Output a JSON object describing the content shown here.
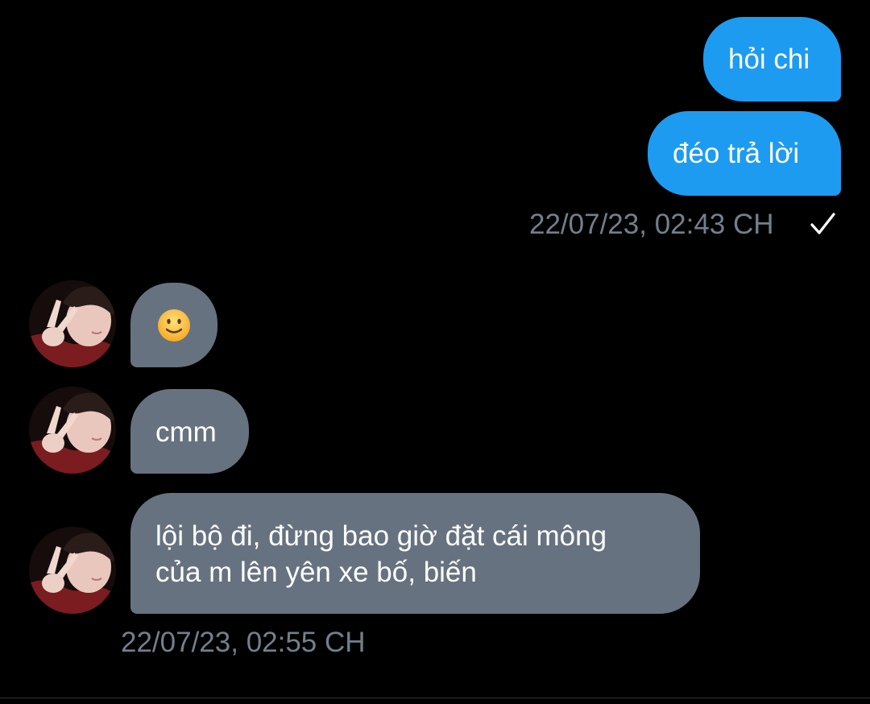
{
  "conversation": {
    "sent_group": {
      "messages": [
        "hỏi chi",
        "đéo trả lời"
      ],
      "timestamp": "22/07/23, 02:43 CH",
      "status_icon": "checkmark-icon"
    },
    "received_group": {
      "messages": [
        "🙂",
        "cmm",
        "lội bộ đi, đừng bao giờ đặt cái mông",
        "của m lên yên xe bố, biến"
      ],
      "timestamp": "22/07/23, 02:55 CH",
      "avatar_icon": "user-avatar"
    }
  },
  "colors": {
    "background": "#000000",
    "sent_bubble": "#1d9bf0",
    "received_bubble": "#66727f",
    "timestamp": "#71808c"
  }
}
